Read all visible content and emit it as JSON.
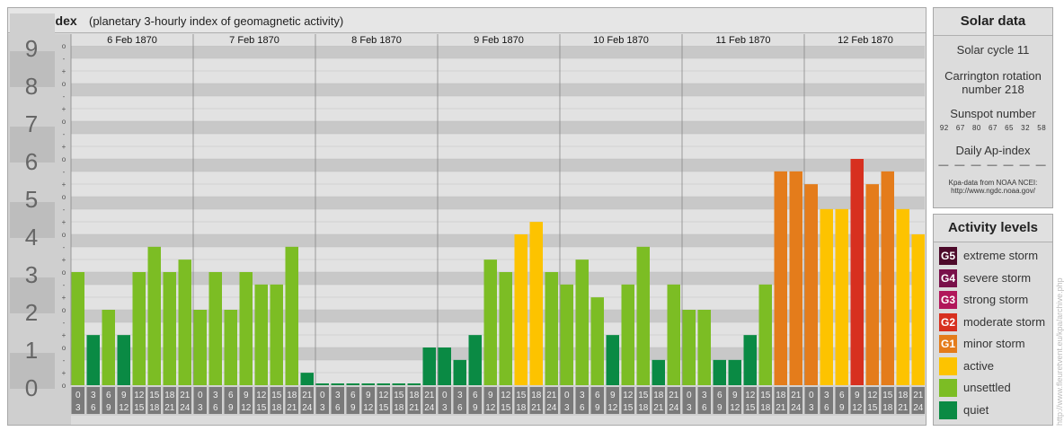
{
  "header": {
    "title": "Kpa-index",
    "subtitle": "(planetary 3-hourly index of geomagnetic activity)"
  },
  "chart_data": {
    "type": "bar",
    "ylim": [
      0,
      9
    ],
    "y_ticks": [
      "0",
      "1",
      "2",
      "3",
      "4",
      "5",
      "6",
      "7",
      "8",
      "9"
    ],
    "minor_tick_labels": [
      "o",
      "+",
      "-"
    ],
    "dates": [
      "6 Feb 1870",
      "7 Feb 1870",
      "8 Feb 1870",
      "9 Feb 1870",
      "10 Feb 1870",
      "11 Feb 1870",
      "12 Feb 1870"
    ],
    "hour_start_labels": [
      "0",
      "3",
      "6",
      "9",
      "12",
      "15",
      "18",
      "21"
    ],
    "hour_end_labels": [
      "3",
      "6",
      "9",
      "12",
      "15",
      "18",
      "21",
      "24"
    ],
    "values": [
      [
        3.0,
        1.33,
        2.0,
        1.33,
        3.0,
        3.67,
        3.0,
        3.33
      ],
      [
        2.0,
        3.0,
        2.0,
        3.0,
        2.67,
        2.67,
        3.67,
        0.33
      ],
      [
        0,
        0,
        0,
        0,
        0,
        0,
        0,
        1.0
      ],
      [
        1.0,
        0.67,
        1.33,
        3.33,
        3.0,
        4.0,
        4.33,
        3.0
      ],
      [
        2.67,
        3.33,
        2.33,
        1.33,
        2.67,
        3.67,
        0.67,
        2.67
      ],
      [
        2.0,
        2.0,
        0.67,
        0.67,
        1.33,
        2.67,
        5.67,
        5.67
      ],
      [
        5.33,
        4.67,
        4.67,
        6.0,
        5.33,
        5.67,
        4.67,
        4.0
      ]
    ],
    "colors": {
      "quiet": "#0a8a44",
      "unsettled": "#7cbd24",
      "active": "#fdc300",
      "g1": "#e47c1b",
      "g2": "#d7301f",
      "g3": "#b1165a",
      "g4": "#79104a",
      "g5": "#4d0a2a"
    }
  },
  "solar_data": {
    "title": "Solar data",
    "cycle": "Solar cycle 11",
    "carrington_line1": "Carrington rotation",
    "carrington_line2": "number 218",
    "sunspot_title": "Sunspot number",
    "sunspot_values": "92   67   80   67   65   32   58",
    "ap_title": "Daily Ap-index",
    "ap_values": "— — — — — — —",
    "source_line1": "Kpa-data from NOAA NCEI:",
    "source_line2": "http://www.ngdc.noaa.gov/"
  },
  "activity_levels": {
    "title": "Activity levels",
    "items": [
      {
        "code": "G5",
        "label": "extreme storm",
        "color": "#4d0a2a"
      },
      {
        "code": "G4",
        "label": "severe storm",
        "color": "#79104a"
      },
      {
        "code": "G3",
        "label": "strong storm",
        "color": "#b1165a"
      },
      {
        "code": "G2",
        "label": "moderate storm",
        "color": "#d7301f"
      },
      {
        "code": "G1",
        "label": "minor storm",
        "color": "#e47c1b"
      },
      {
        "code": "",
        "label": "active",
        "color": "#fdc300"
      },
      {
        "code": "",
        "label": "unsettled",
        "color": "#7cbd24"
      },
      {
        "code": "",
        "label": "quiet",
        "color": "#0a8a44"
      }
    ]
  },
  "watermark": "http://www.fleuretvent.eu/kpa/archive.php"
}
